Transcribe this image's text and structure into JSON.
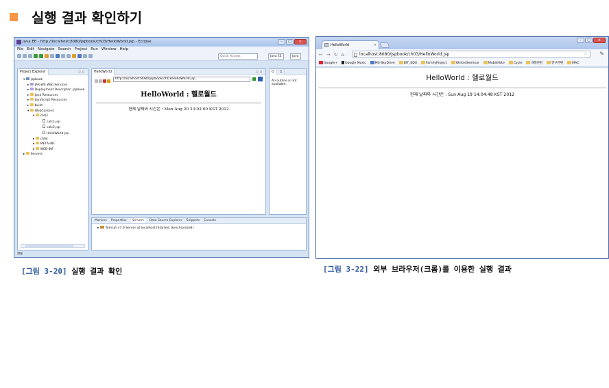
{
  "slide": {
    "title": "실행 결과 확인하기",
    "accent": "#f79646"
  },
  "eclipse": {
    "window_title": "Java EE - http://localhost:8080/jspbook/ch03/HelloWorld.jsp - Eclipse",
    "menu": [
      "File",
      "Edit",
      "Navigate",
      "Search",
      "Project",
      "Run",
      "Window",
      "Help"
    ],
    "quick_access": "Quick Access",
    "perspectives": [
      "Java EE",
      "Java"
    ],
    "explorer_tab": "Project Explorer",
    "tree": [
      "jspbook",
      "JAX-WS Web Services",
      "Deployment Descriptor: jspbook",
      "Java Resources",
      "JavaScript Resources",
      "build",
      "WebContent",
      "ch03",
      "calc1.jsp",
      "calc2.jsp",
      "HelloWorld.jsp",
      "ch04",
      "META-INF",
      "WEB-INF",
      "Servers"
    ],
    "browser_tab": "HelloWorld",
    "browser_url": "http://localhost:8080/jspbook/ch03/HelloWorld.jsp",
    "page_heading": "HelloWorld : 헬로월드",
    "page_time": "현재 날짜와 시간은 : Mon Aug 20 23:03:00 KST 2012",
    "outline_tabs": [
      "O",
      "1"
    ],
    "outline_message": "An outline is not available.",
    "bottom_tabs": [
      "Markers",
      "Properties",
      "Servers",
      "Data Source Explorer",
      "Snippets",
      "Console"
    ],
    "server_entry": "Tomcat v7.0 Server at localhost  [Started, Synchronized]",
    "status": "완료"
  },
  "chrome": {
    "tab_title": "HelloWorld",
    "url": "localhost:8080/jspbook/ch03/HelloWorld.jsp",
    "bookmarks": [
      "Google+",
      "Google Music",
      "MS-SkyDrive",
      "BIT_EDU",
      "FamilyProject",
      "WinterSeminar",
      "MobileSite",
      "Cycle",
      "개발관련",
      "연구관련",
      "MAC"
    ],
    "page_heading": "HelloWorld : 헬로월드",
    "page_time": "현재 날짜와 시간은 : Sun Aug 19 14:04:48 KST 2012"
  },
  "captions": {
    "left_fig": "[그림 3-20]",
    "left_text": "실행 결과 확인",
    "right_fig": "[그림 3-22]",
    "right_text": "외부 브라우저(크롬)를 이용한 실행 결과"
  }
}
